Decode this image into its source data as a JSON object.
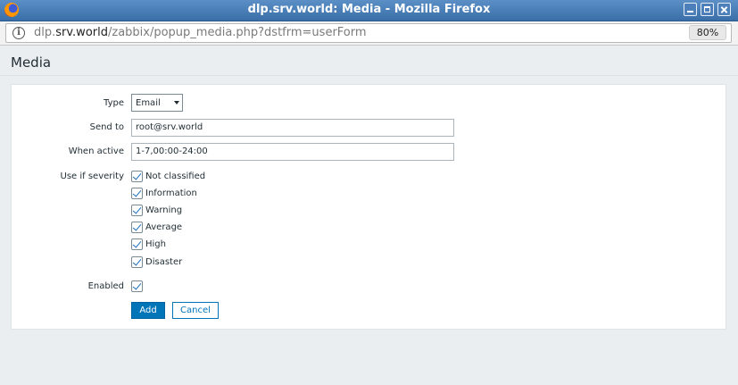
{
  "window": {
    "title": "dlp.srv.world: Media - Mozilla Firefox"
  },
  "browser": {
    "url_prefix": "dlp.",
    "url_host": "srv.world",
    "url_path": "/zabbix/popup_media.php?dstfrm=userForm",
    "zoom": "80%"
  },
  "page": {
    "title": "Media"
  },
  "form": {
    "type_label": "Type",
    "type_value": "Email",
    "send_to_label": "Send to",
    "send_to_value": "root@srv.world",
    "when_active_label": "When active",
    "when_active_value": "1-7,00:00-24:00",
    "severity_label": "Use if severity",
    "severities": [
      {
        "label": "Not classified",
        "checked": true
      },
      {
        "label": "Information",
        "checked": true
      },
      {
        "label": "Warning",
        "checked": true
      },
      {
        "label": "Average",
        "checked": true
      },
      {
        "label": "High",
        "checked": true
      },
      {
        "label": "Disaster",
        "checked": true
      }
    ],
    "enabled_label": "Enabled",
    "enabled_checked": true
  },
  "buttons": {
    "add": "Add",
    "cancel": "Cancel"
  },
  "icons": {
    "browser_logo": "firefox-logo-icon",
    "site_info": "info-icon"
  }
}
